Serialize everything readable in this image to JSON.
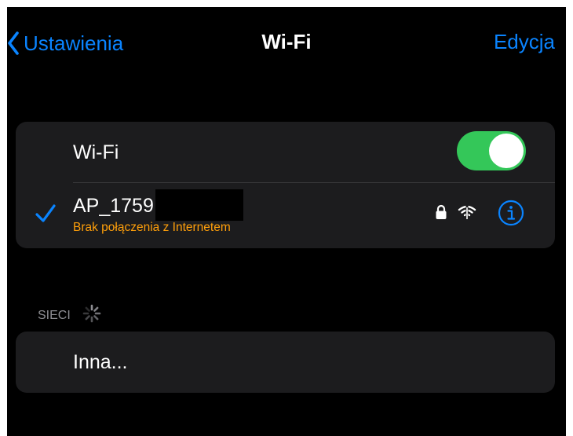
{
  "nav": {
    "back_label": "Ustawienia",
    "title": "Wi-Fi",
    "edit_label": "Edycja"
  },
  "wifi_card": {
    "toggle_label": "Wi-Fi",
    "toggle_on": true,
    "network": {
      "name": "AP_1759",
      "status": "Brak połączenia z Internetem",
      "connected": true,
      "secured": true,
      "icons": [
        "checkmark-icon",
        "lock-icon",
        "wifi-no-internet-icon",
        "info-icon"
      ]
    }
  },
  "networks_section": {
    "header": "SIECI",
    "loading": true,
    "other_label": "Inna..."
  },
  "colors": {
    "background": "#000000",
    "card": "#1c1c1e",
    "separator": "#38383a",
    "accent_blue": "#0a84ff",
    "toggle_green": "#34c759",
    "warning_orange": "#ff9f0a",
    "secondary_text": "#8e8e93",
    "primary_text": "#ffffff"
  }
}
